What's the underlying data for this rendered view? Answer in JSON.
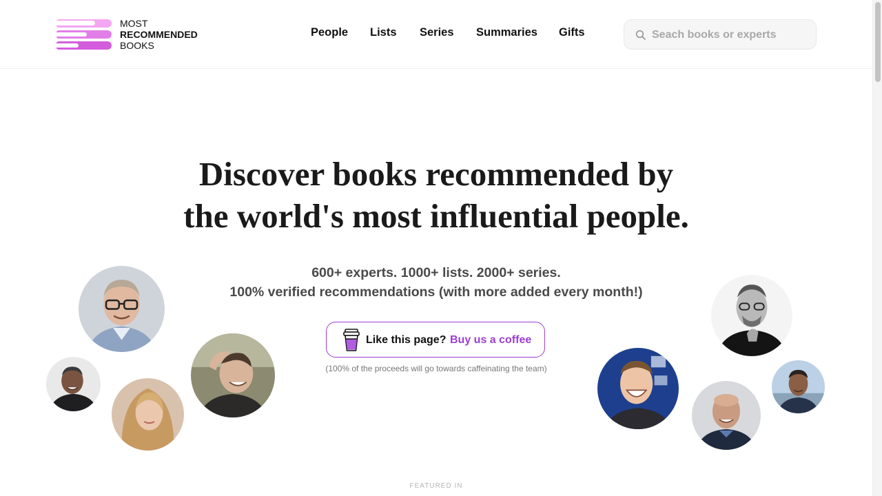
{
  "logo": {
    "line1": "MOST",
    "line2": "RECOMMENDED",
    "line3": "BOOKS",
    "bar_colors": [
      "#f3a6f1",
      "#e27ee8",
      "#d35ddd"
    ]
  },
  "nav": {
    "items": [
      {
        "label": "People"
      },
      {
        "label": "Lists"
      },
      {
        "label": "Series"
      },
      {
        "label": "Summaries"
      },
      {
        "label": "Gifts"
      }
    ]
  },
  "search": {
    "placeholder": "Seach books or experts",
    "icon": "search-icon"
  },
  "hero": {
    "headline_line1": "Discover books recommended by",
    "headline_line2": "the world's most influential people.",
    "stats_line": "600+ experts. 1000+ lists. 2000+ series.",
    "verified_line": "100% verified recommendations (with more added every month!)"
  },
  "coffee": {
    "label": "Like this page?",
    "link": "Buy us a coffee",
    "note": "(100% of the proceeds will go towards caffeinating the team)",
    "accent": "#9a3fd1",
    "icon": "coffee-cup-icon"
  },
  "featured": {
    "label": "FEATURED IN"
  },
  "avatars": {
    "icon": "portrait-photo"
  }
}
